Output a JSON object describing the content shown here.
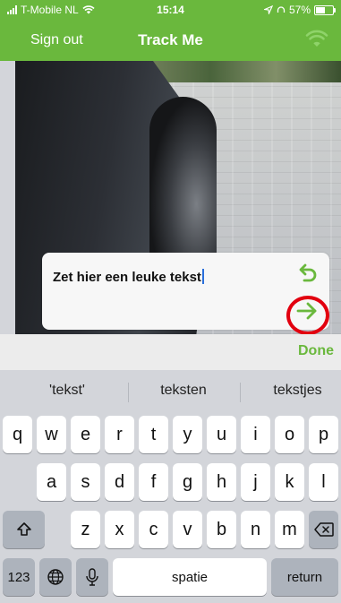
{
  "status_bar": {
    "carrier": "T-Mobile NL",
    "time": "15:14",
    "battery": "57%",
    "battery_level": 0.57
  },
  "nav": {
    "left_label": "Sign out",
    "title": "Track Me",
    "right_icon": "wifi-icon"
  },
  "text_card": {
    "text": "Zet hier een leuke tekst",
    "undo_icon": "undo-icon",
    "submit_icon": "arrow-right-icon"
  },
  "accessory": {
    "done_label": "Done"
  },
  "keyboard": {
    "suggestions": [
      "'tekst'",
      "teksten",
      "tekstjes"
    ],
    "row1": [
      "q",
      "w",
      "e",
      "r",
      "t",
      "y",
      "u",
      "i",
      "o",
      "p"
    ],
    "row2": [
      "a",
      "s",
      "d",
      "f",
      "g",
      "h",
      "j",
      "k",
      "l"
    ],
    "row3": [
      "z",
      "x",
      "c",
      "v",
      "b",
      "n",
      "m"
    ],
    "numbers_label": "123",
    "space_label": "spatie",
    "return_label": "return"
  },
  "colors": {
    "brand_green": "#6ab83d",
    "highlight_red": "#e2000f"
  }
}
